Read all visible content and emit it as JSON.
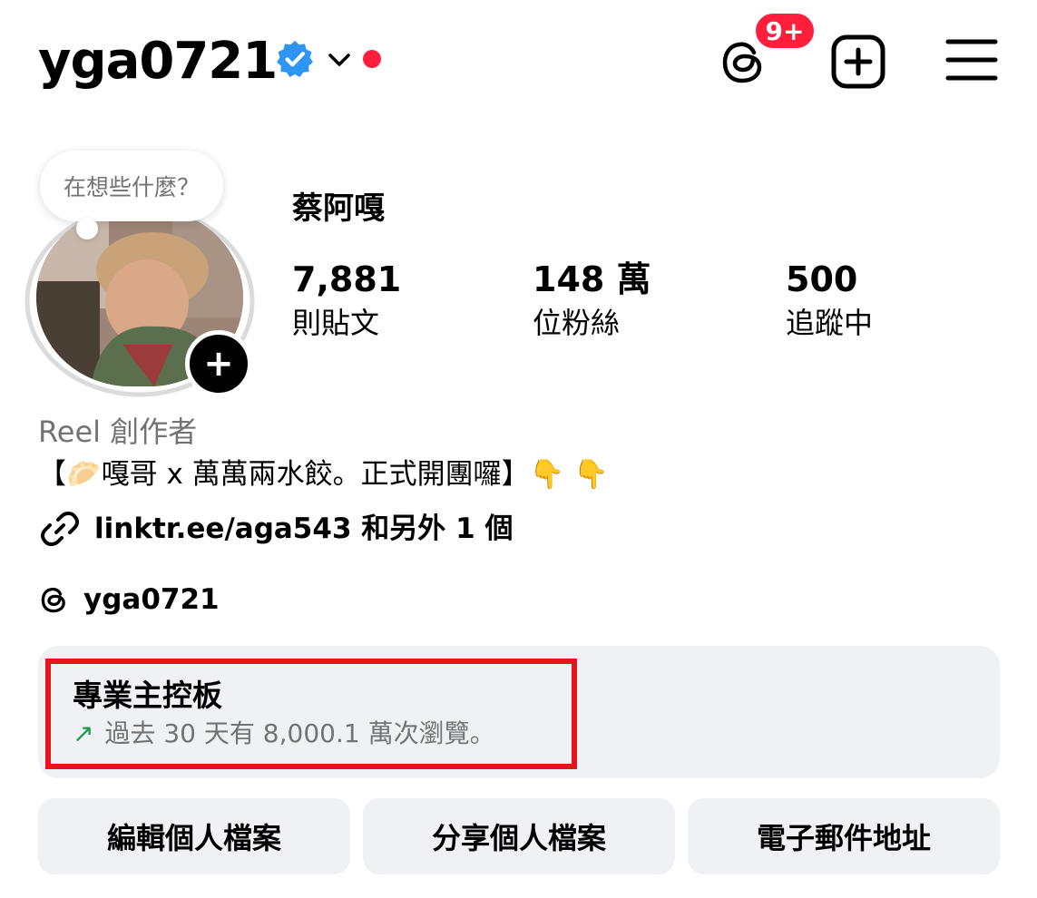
{
  "header": {
    "username": "yga0721",
    "notification_badge": "9+"
  },
  "avatar": {
    "note_placeholder": "在想些什麼？",
    "add_symbol": "+"
  },
  "profile": {
    "display_name": "蔡阿嘎",
    "stats": [
      {
        "number": "7,881",
        "label": "則貼文"
      },
      {
        "number": "148 萬",
        "label": "位粉絲"
      },
      {
        "number": "500",
        "label": "追蹤中"
      }
    ],
    "category": "Reel 創作者",
    "bio": "【🥟嘎哥 x 萬萬兩水餃。正式開團囉】👇 👇",
    "link": "linktr.ee/aga543 和另外 1 個",
    "threads_handle": "yga0721"
  },
  "dashboard": {
    "title": "專業主控板",
    "arrow": "↗",
    "subtitle": "過去 30 天有 8,000.1 萬次瀏覽。"
  },
  "buttons": {
    "edit_profile": "編輯個人檔案",
    "share_profile": "分享個人檔案",
    "email": "電子郵件地址"
  },
  "colors": {
    "verified_blue": "#2f95f5",
    "badge_red": "#ff1f3d",
    "highlight_red": "#e4151b",
    "trend_green": "#1b9a4b",
    "muted_gray": "#737373",
    "button_bg": "#eff1f4"
  },
  "icons": [
    "verified-badge-icon",
    "chevron-down-icon",
    "threads-icon",
    "plus-square-icon",
    "hamburger-menu-icon",
    "link-icon",
    "trend-up-arrow-icon"
  ]
}
